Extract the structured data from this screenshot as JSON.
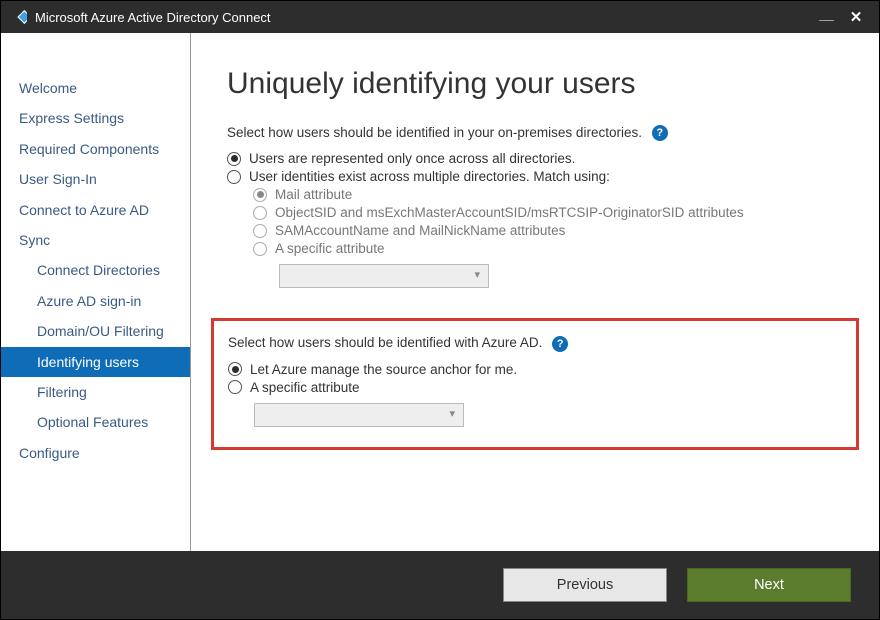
{
  "window": {
    "title": "Microsoft Azure Active Directory Connect"
  },
  "sidebar": {
    "items": [
      {
        "label": "Welcome",
        "sub": false,
        "selected": false
      },
      {
        "label": "Express Settings",
        "sub": false,
        "selected": false
      },
      {
        "label": "Required Components",
        "sub": false,
        "selected": false
      },
      {
        "label": "User Sign-In",
        "sub": false,
        "selected": false
      },
      {
        "label": "Connect to Azure AD",
        "sub": false,
        "selected": false
      },
      {
        "label": "Sync",
        "sub": false,
        "selected": false
      },
      {
        "label": "Connect Directories",
        "sub": true,
        "selected": false
      },
      {
        "label": "Azure AD sign-in",
        "sub": true,
        "selected": false
      },
      {
        "label": "Domain/OU Filtering",
        "sub": true,
        "selected": false
      },
      {
        "label": "Identifying users",
        "sub": true,
        "selected": true
      },
      {
        "label": "Filtering",
        "sub": true,
        "selected": false
      },
      {
        "label": "Optional Features",
        "sub": true,
        "selected": false
      },
      {
        "label": "Configure",
        "sub": false,
        "selected": false
      }
    ]
  },
  "page": {
    "title": "Uniquely identifying your users",
    "section1": {
      "label": "Select how users should be identified in your on-premises directories.",
      "opt_once": "Users are represented only once across all directories.",
      "opt_match": "User identities exist across multiple directories. Match using:",
      "sub_mail": "Mail attribute",
      "sub_sid": "ObjectSID and msExchMasterAccountSID/msRTCSIP-OriginatorSID attributes",
      "sub_sam": "SAMAccountName and MailNickName attributes",
      "sub_specific": "A specific attribute"
    },
    "section2": {
      "label": "Select how users should be identified with Azure AD.",
      "opt_auto": "Let Azure manage the source anchor for me.",
      "opt_specific": "A specific attribute"
    }
  },
  "footer": {
    "previous": "Previous",
    "next": "Next"
  }
}
